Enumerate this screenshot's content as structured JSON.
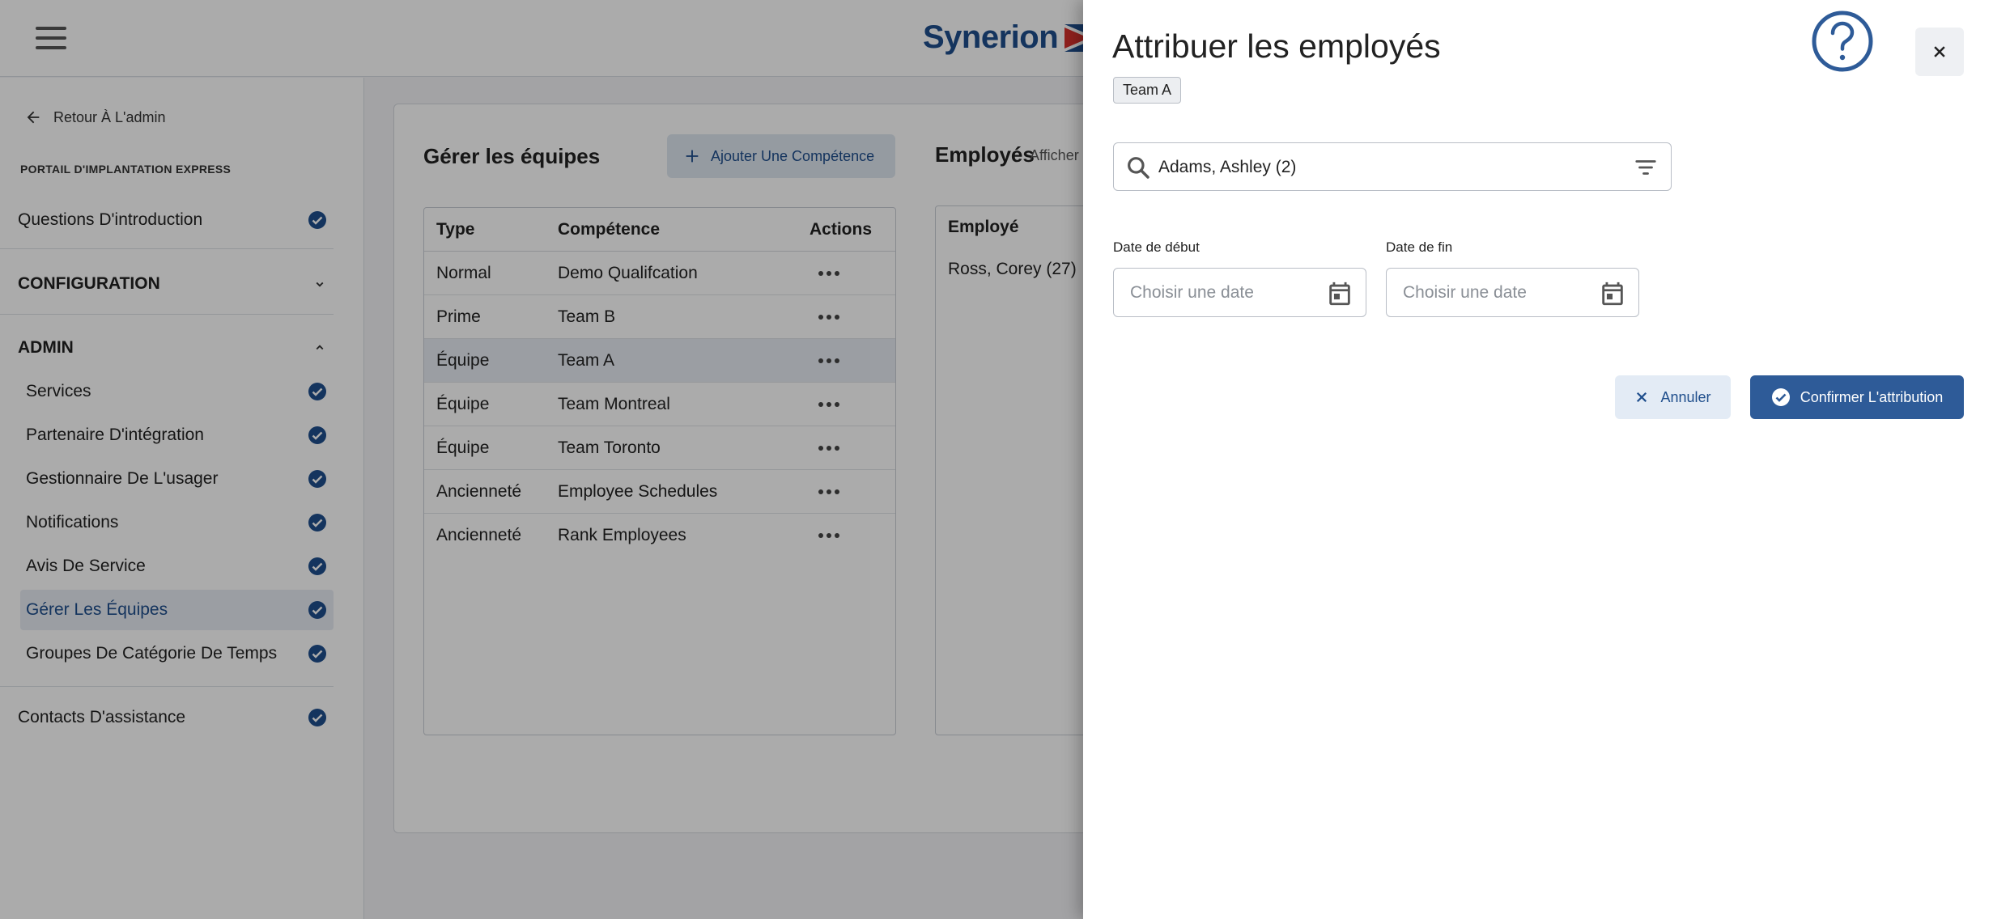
{
  "header": {
    "brand_name": "Synerion"
  },
  "sidebar": {
    "back_label": "Retour À L'admin",
    "portal_label": "PORTAIL D'IMPLANTATION EXPRESS",
    "intro": "Questions D'introduction",
    "section_config": "CONFIGURATION",
    "section_admin": "ADMIN",
    "admin_items": [
      {
        "label": "Services"
      },
      {
        "label": "Partenaire D'intégration"
      },
      {
        "label": "Gestionnaire De L'usager"
      },
      {
        "label": "Notifications"
      },
      {
        "label": "Avis De Service"
      },
      {
        "label": "Gérer Les Équipes"
      },
      {
        "label": "Groupes De Catégorie De Temps"
      }
    ],
    "contacts": "Contacts D'assistance"
  },
  "main": {
    "title": "Gérer les équipes",
    "add_button": "Ajouter Une Compétence",
    "table": {
      "headers": [
        "Type",
        "Compétence",
        "Actions"
      ],
      "rows": [
        {
          "type": "Normal",
          "skill": "Demo Qualifcation"
        },
        {
          "type": "Prime",
          "skill": "Team B"
        },
        {
          "type": "Équipe",
          "skill": "Team A"
        },
        {
          "type": "Équipe",
          "skill": "Team Montreal"
        },
        {
          "type": "Équipe",
          "skill": "Team Toronto"
        },
        {
          "type": "Ancienneté",
          "skill": "Employee Schedules"
        },
        {
          "type": "Ancienneté",
          "skill": "Rank Employees"
        }
      ]
    },
    "employees": {
      "title": "Employés",
      "subtitle": "Afficher",
      "header": "Employé",
      "rows": [
        "Ross, Corey (27)"
      ]
    }
  },
  "drawer": {
    "title": "Attribuer les employés",
    "chip": "Team A",
    "search_value": "Adams, Ashley (2)",
    "start_label": "Date de début",
    "end_label": "Date de fin",
    "date_placeholder": "Choisir une date",
    "cancel_label": "Annuler",
    "confirm_label": "Confirmer L'attribution"
  },
  "colors": {
    "accent": "#2e5b98",
    "brand_blue": "#1f4e8c",
    "brand_red": "#d6312c"
  }
}
